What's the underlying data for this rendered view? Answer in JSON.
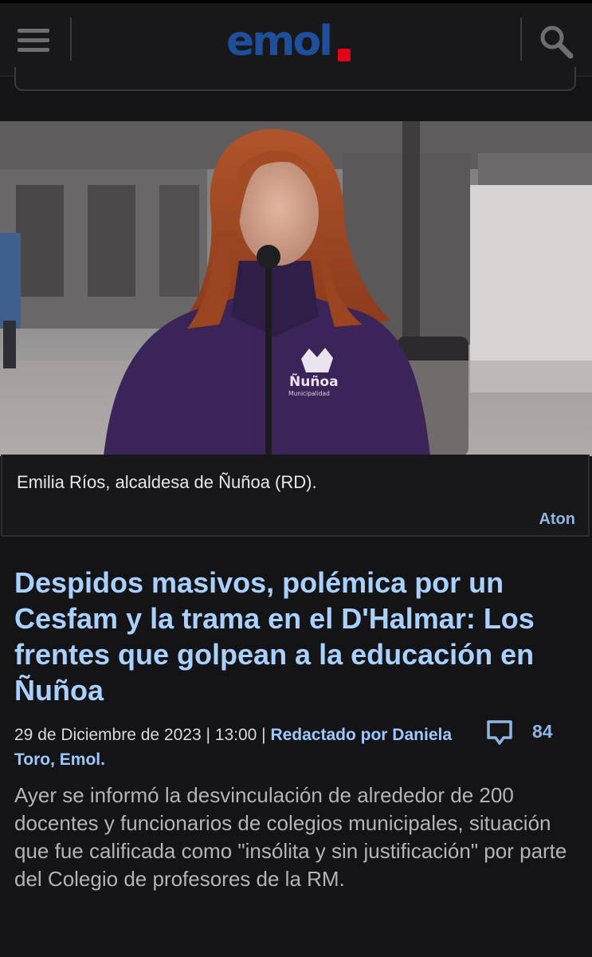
{
  "header": {
    "logo_text": "emol",
    "brand_color": "#1d4f9c",
    "accent_color": "#e2001a",
    "menu_icon": "hamburger-icon",
    "search_icon": "search-icon"
  },
  "photo": {
    "caption": "Emilia Ríos, alcaldesa de Ñuñoa (RD).",
    "credit": "Aton",
    "jacket_text": "Ñuñoa",
    "jacket_subtext": "Municipalidad"
  },
  "article": {
    "headline": "Despidos masivos, polémica por un Cesfam y la trama en el D'Halmar: Los frentes que golpean a la educación en Ñuñoa",
    "date": "29 de Diciembre de 2023 | 13:00 | ",
    "author": "Redactado por Daniela Toro, Emol.",
    "comment_count": "84",
    "comment_icon": "comment-bubble-icon",
    "lead": "Ayer se informó la desvinculación de alrededor de 200 docentes y funcionarios de colegios municipales, situación que fue calificada como \"insólita y sin justificación\" por parte del Colegio de profesores de la RM."
  }
}
